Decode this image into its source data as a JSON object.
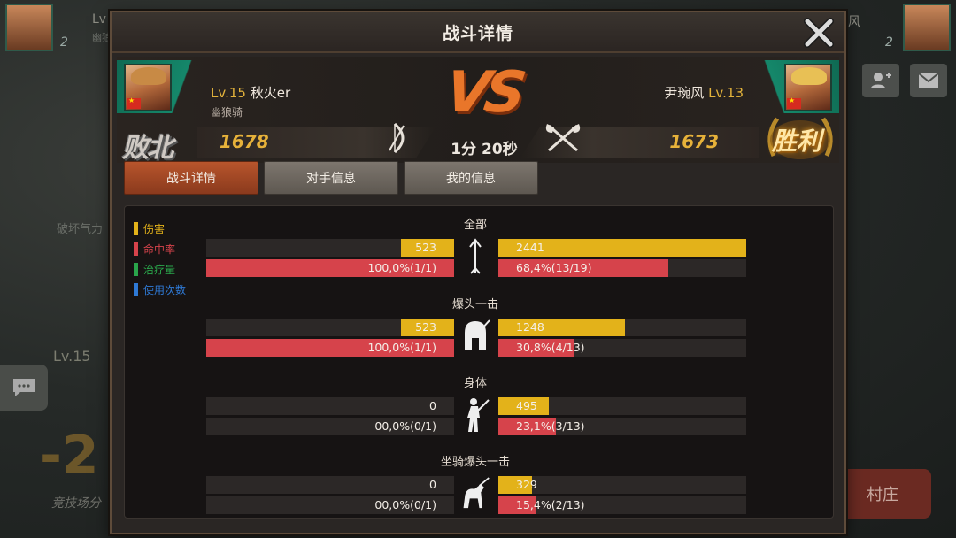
{
  "background": {
    "left_text": "破坏气力",
    "left_level": "Lv.15",
    "big_number": "-2",
    "arena_text": "竞技场分",
    "village_button": "村庄",
    "top_left_level": "Lv",
    "top_left_guild": "幽狼",
    "top_left_badge": "2",
    "top_right_name": "风",
    "top_right_badge": "2"
  },
  "dialog": {
    "title": "战斗详情"
  },
  "player_left": {
    "level": "Lv.15",
    "name": "秋火er",
    "guild": "幽狼骑",
    "score": "1678",
    "result": "败北"
  },
  "player_right": {
    "level": "Lv.13",
    "name": "尹琬风",
    "score": "1673",
    "result": "胜利"
  },
  "match": {
    "vs_text": "VS",
    "duration": "1分 20秒"
  },
  "tabs": [
    {
      "label": "战斗详情",
      "active": true
    },
    {
      "label": "对手信息",
      "active": false
    },
    {
      "label": "我的信息",
      "active": false
    }
  ],
  "legend": [
    {
      "label": "伤害",
      "color": "#e3b21a"
    },
    {
      "label": "命中率",
      "color": "#d6434b"
    },
    {
      "label": "治疗量",
      "color": "#2aa54b"
    },
    {
      "label": "使用次数",
      "color": "#2f7ad6"
    }
  ],
  "colors": {
    "damage": "#e3b21a",
    "accuracy": "#d6434b",
    "accent": "#b8552c"
  },
  "sections": [
    {
      "title": "全部",
      "icon": "arrow-icon",
      "left_damage": "523",
      "left_damage_fill": 0.214,
      "left_acc": "100,0%(1/1)",
      "left_acc_fill": 1.0,
      "right_damage": "2441",
      "right_damage_fill": 1.0,
      "right_acc": "68,4%(13/19)",
      "right_acc_fill": 0.684
    },
    {
      "title": "爆头一击",
      "icon": "helmet-icon",
      "left_damage": "523",
      "left_damage_fill": 0.214,
      "left_acc": "100,0%(1/1)",
      "left_acc_fill": 1.0,
      "right_damage": "1248",
      "right_damage_fill": 0.511,
      "right_acc": "30,8%(4/13)",
      "right_acc_fill": 0.308
    },
    {
      "title": "身体",
      "icon": "body-icon",
      "left_damage": "0",
      "left_damage_fill": 0.0,
      "left_acc": "00,0%(0/1)",
      "left_acc_fill": 0.0,
      "right_damage": "495",
      "right_damage_fill": 0.203,
      "right_acc": "23,1%(3/13)",
      "right_acc_fill": 0.231
    },
    {
      "title": "坐骑爆头一击",
      "icon": "horse-icon",
      "left_damage": "0",
      "left_damage_fill": 0.0,
      "left_acc": "00,0%(0/1)",
      "left_acc_fill": 0.0,
      "right_damage": "329",
      "right_damage_fill": 0.135,
      "right_acc": "15,4%(2/13)",
      "right_acc_fill": 0.154
    }
  ]
}
